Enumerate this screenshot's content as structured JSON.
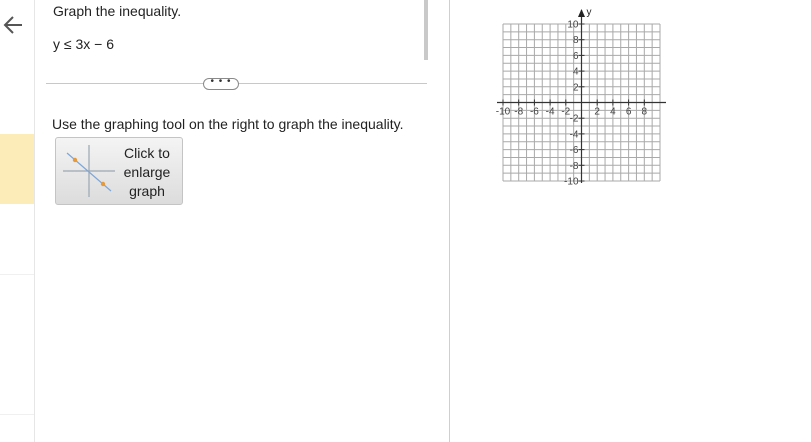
{
  "nav": {
    "back_icon": "arrow-left-icon"
  },
  "question": {
    "title": "Graph the inequality.",
    "expression": "y ≤ 3x − 6",
    "more_label": "• • •",
    "instruction": "Use the graphing tool on the right to graph the inequality.",
    "enlarge_lines": [
      "Click to",
      "enlarge",
      "graph"
    ]
  },
  "graph": {
    "x_axis_label": "",
    "y_axis_label": "y",
    "x_range": [
      -10,
      10
    ],
    "y_range": [
      -10,
      10
    ],
    "x_ticks": [
      -10,
      -8,
      -6,
      -4,
      -2,
      2,
      4,
      6,
      8
    ],
    "y_ticks": [
      10,
      8,
      6,
      4,
      2,
      -2,
      -4,
      -6,
      -8,
      -10
    ],
    "grid": true,
    "accent": "#e69a3a"
  }
}
